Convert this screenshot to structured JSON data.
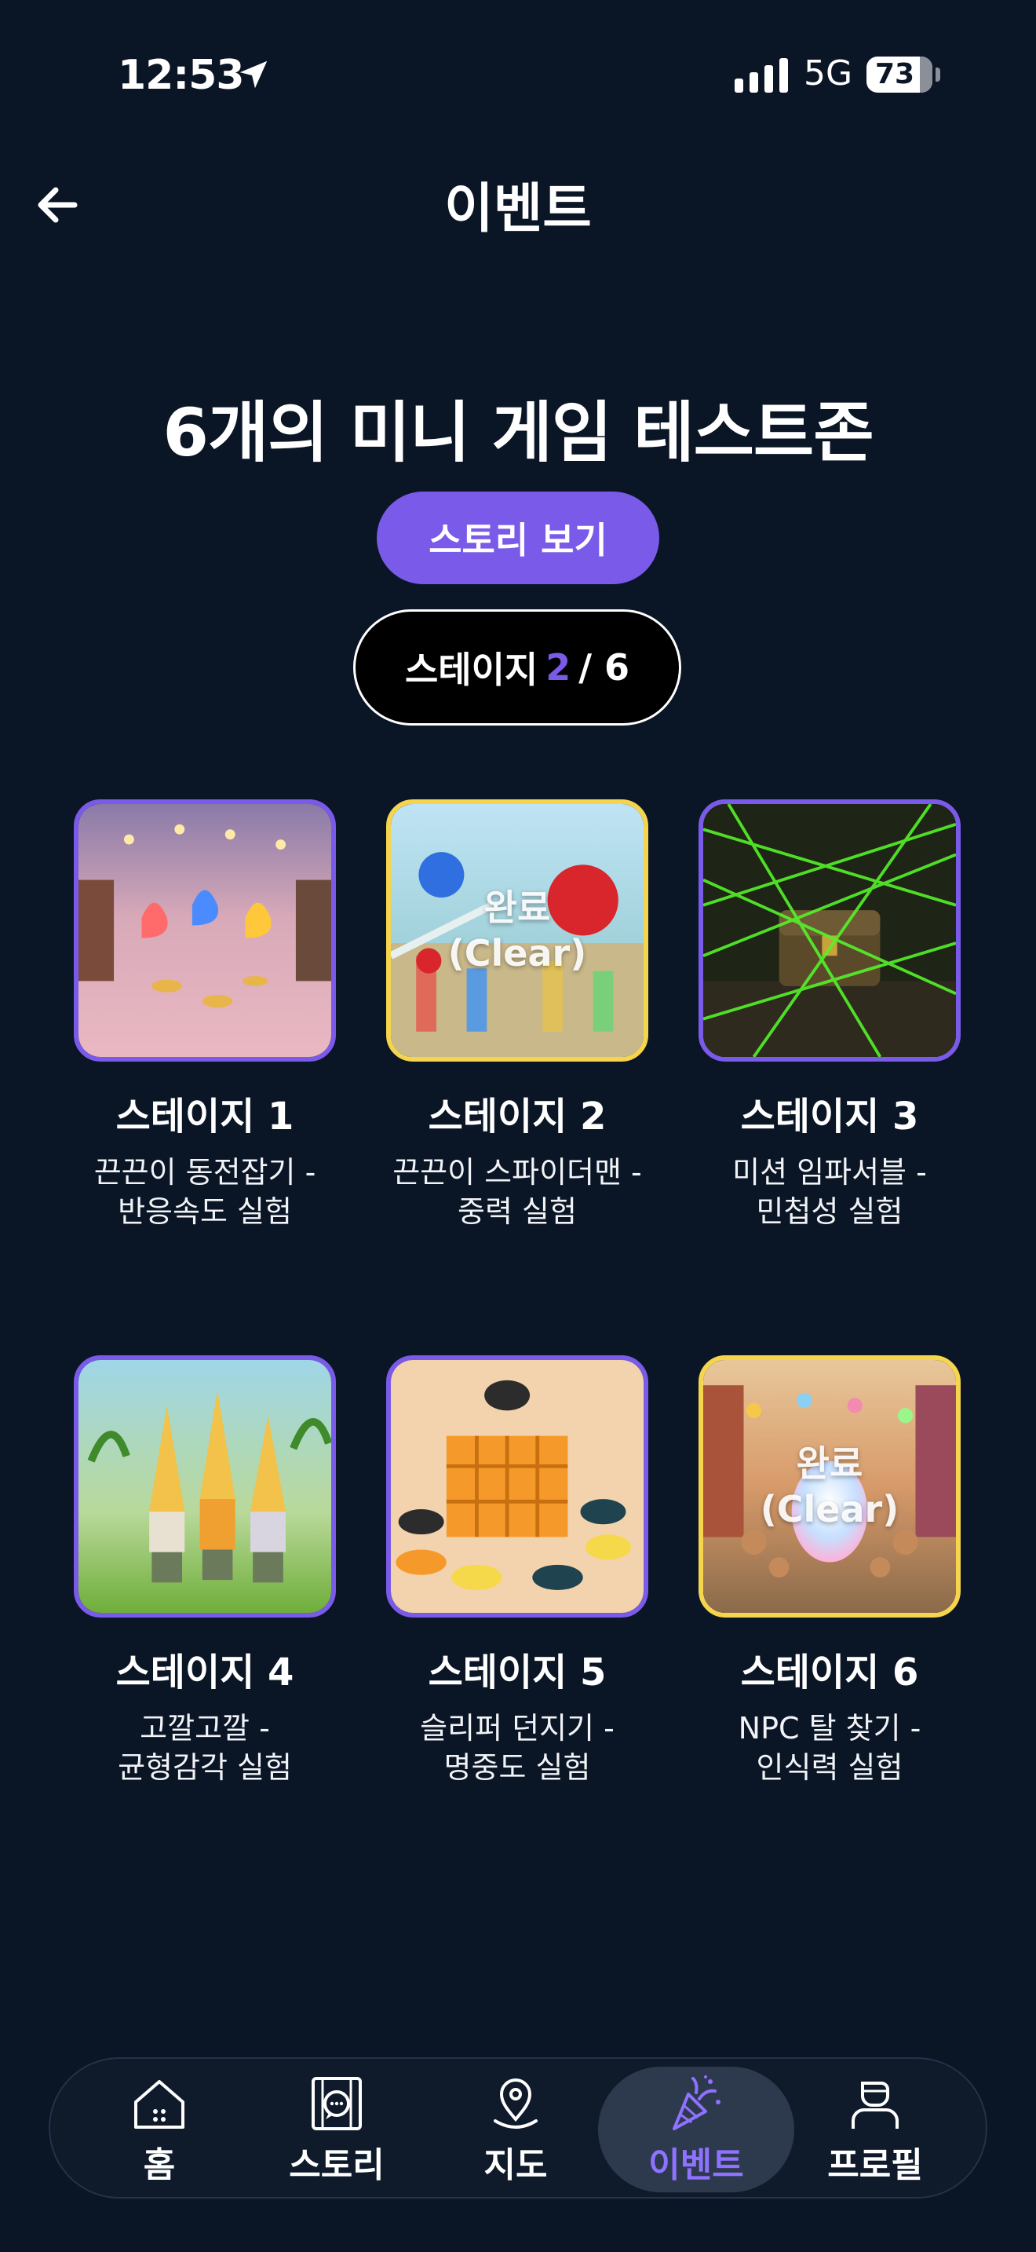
{
  "status_bar": {
    "time": "12:53",
    "network": "5G",
    "battery": "73",
    "battery_level": 0.73
  },
  "header": {
    "title": "이벤트",
    "back_icon": "arrow-left-icon"
  },
  "hero": {
    "title": "6개의 미니 게임 테스트존",
    "story_button": "스토리 보기",
    "stage_prefix": "스테이지",
    "stage_current": "2",
    "stage_total": "/ 6"
  },
  "stages": [
    {
      "name": "스테이지 1",
      "desc_1": "끈끈이 동전잡기 -",
      "desc_2": "반응속도 실험",
      "cleared": false
    },
    {
      "name": "스테이지 2",
      "desc_1": "끈끈이 스파이더맨 -",
      "desc_2": "중력 실험",
      "cleared": true,
      "overlay_1": "완료",
      "overlay_2": "(Clear)"
    },
    {
      "name": "스테이지 3",
      "desc_1": "미션 임파서블 -",
      "desc_2": "민첩성 실험",
      "cleared": false
    },
    {
      "name": "스테이지 4",
      "desc_1": "고깔고깔 -",
      "desc_2": "균형감각 실험",
      "cleared": false
    },
    {
      "name": "스테이지 5",
      "desc_1": "슬리퍼 던지기 -",
      "desc_2": "명중도 실험",
      "cleared": false
    },
    {
      "name": "스테이지 6",
      "desc_1": "NPC 탈 찾기 -",
      "desc_2": "인식력 실험",
      "cleared": true,
      "overlay_1": "완료",
      "overlay_2": "(Clear)"
    }
  ],
  "nav": {
    "items": [
      {
        "label": "홈",
        "icon": "home-icon"
      },
      {
        "label": "스토리",
        "icon": "story-book-icon"
      },
      {
        "label": "지도",
        "icon": "map-pin-icon"
      },
      {
        "label": "이벤트",
        "icon": "party-popper-icon",
        "active": true
      },
      {
        "label": "프로필",
        "icon": "profile-icon"
      }
    ]
  },
  "colors": {
    "background": "#0a1525",
    "accent": "#7a5ae8",
    "cleared_border": "#f5d44e",
    "nav_active_label": "#8f72ff"
  }
}
